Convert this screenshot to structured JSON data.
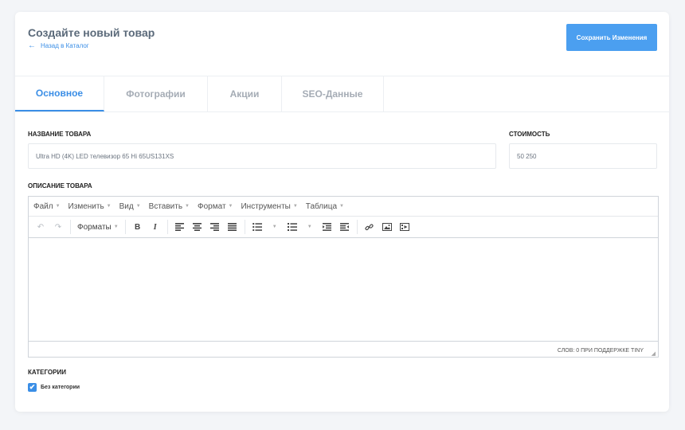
{
  "header": {
    "title": "Создайте новый товар",
    "back_arrow": "←",
    "back_label": "Назад в Каталог",
    "save_label": "Сохранить Изменения"
  },
  "tabs": [
    {
      "label": "Основное",
      "active": true
    },
    {
      "label": "Фотографии",
      "active": false
    },
    {
      "label": "Акции",
      "active": false
    },
    {
      "label": "SEO-Данные",
      "active": false
    }
  ],
  "form": {
    "name_label": "НАЗВАНИЕ ТОВАРА",
    "name_value": "Ultra HD (4K) LED телевизор 65 Hi 65US131XS",
    "price_label": "СТОИМОСТЬ",
    "price_value": "50 250",
    "description_label": "ОПИСАНИЕ ТОВАРА",
    "categories_label": "КАТЕГОРИИ",
    "category_option": "Без категории",
    "category_checked": true
  },
  "editor": {
    "menu": [
      "Файл",
      "Изменить",
      "Вид",
      "Вставить",
      "Формат",
      "Инструменты",
      "Таблица"
    ],
    "formats_label": "Форматы",
    "status": "СЛОВ: 0 ПРИ ПОДДЕРЖКЕ TINY"
  },
  "colors": {
    "accent": "#3a8ee6",
    "button": "#4b9ff0",
    "background": "#f3f5f8"
  }
}
